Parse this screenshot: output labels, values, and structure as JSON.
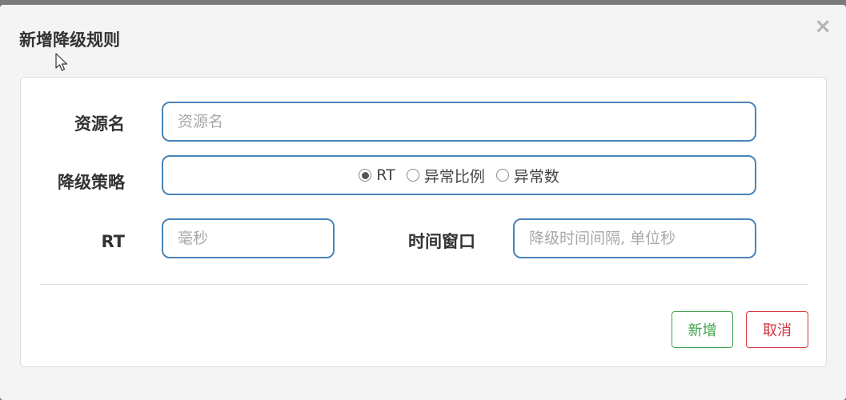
{
  "dialog": {
    "title": "新增降级规则",
    "close_glyph": "×"
  },
  "form": {
    "resource": {
      "label": "资源名",
      "placeholder": "资源名",
      "value": ""
    },
    "strategy": {
      "label": "降级策略",
      "options": [
        {
          "label": "RT",
          "checked": true
        },
        {
          "label": "异常比例",
          "checked": false
        },
        {
          "label": "异常数",
          "checked": false
        }
      ]
    },
    "rt": {
      "label": "RT",
      "placeholder": "毫秒",
      "value": ""
    },
    "time_window": {
      "label": "时间窗口",
      "placeholder": "降级时间间隔, 单位秒",
      "value": ""
    }
  },
  "actions": {
    "add_label": "新增",
    "cancel_label": "取消"
  },
  "colors": {
    "input_border": "#4a84b8",
    "add_button": "#3fa34d",
    "cancel_button": "#d9343d"
  },
  "icons": {
    "close": "close-icon",
    "cursor": "mouse-cursor-icon"
  }
}
